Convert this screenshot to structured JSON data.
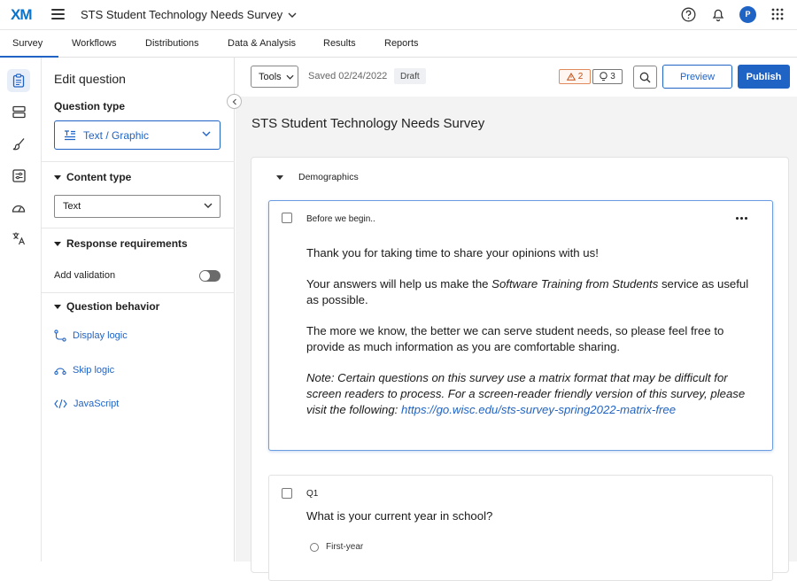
{
  "app": {
    "logo": "XM",
    "survey_title": "STS Student Technology Needs Survey",
    "avatar_initial": "P"
  },
  "nav": {
    "tabs": [
      {
        "label": "Survey",
        "active": true
      },
      {
        "label": "Workflows"
      },
      {
        "label": "Distributions"
      },
      {
        "label": "Data & Analysis"
      },
      {
        "label": "Results"
      },
      {
        "label": "Reports"
      }
    ]
  },
  "rail": {
    "icons": [
      "clipboard-icon",
      "blocks-icon",
      "brush-icon",
      "settings-sliders-icon",
      "gauge-icon",
      "translate-icon"
    ]
  },
  "left_panel": {
    "title": "Edit question",
    "question_type_label": "Question type",
    "question_type_value": "Text / Graphic",
    "content_type_label": "Content type",
    "content_type_value": "Text",
    "response_requirements_label": "Response requirements",
    "add_validation_label": "Add validation",
    "add_validation_on": false,
    "question_behavior_label": "Question behavior",
    "display_logic": "Display logic",
    "skip_logic": "Skip logic",
    "javascript": "JavaScript"
  },
  "toolbar": {
    "tools": "Tools",
    "saved": "Saved 02/24/2022",
    "status": "Draft",
    "warnings_count": "2",
    "ideas_count": "3",
    "preview": "Preview",
    "publish": "Publish"
  },
  "editor": {
    "survey_name": "STS Student Technology Needs Survey",
    "block_name": "Demographics",
    "intro": {
      "id": "Before we begin..",
      "p1": "Thank you for taking time to share your opinions with us!",
      "p2_before": "Your answers will help us make the ",
      "p2_em": "Software Training from Students",
      "p2_after": " service as useful as possible.",
      "p3": "The more we know, the better we can serve student needs, so please feel free to provide as much information as you are comfortable sharing.",
      "note": "Note: Certain questions on this survey use a matrix format that may be difficult for screen readers to process. For a screen-reader friendly version of this survey, please visit the following: ",
      "link": "https://go.wisc.edu/sts-survey-spring2022-matrix-free"
    },
    "q1": {
      "id": "Q1",
      "text": "What is your current year in school?",
      "choices": [
        "First-year"
      ]
    }
  }
}
